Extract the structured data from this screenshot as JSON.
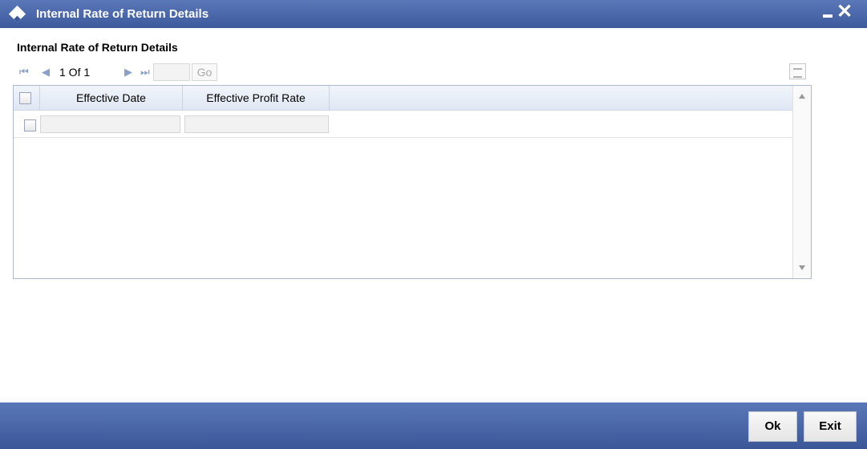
{
  "window": {
    "title": "Internal Rate of Return Details",
    "minimize_icon": "minimize-icon",
    "close_icon": "close-icon",
    "accent": "#3d5a9d"
  },
  "section": {
    "title": "Internal Rate of Return Details"
  },
  "pagination": {
    "page_text": "1 Of 1",
    "page_value": "",
    "go_label": "Go"
  },
  "grid": {
    "columns": [
      "Effective Date",
      "Effective Profit Rate"
    ],
    "rows": [
      {
        "selected": false,
        "effective_date": "",
        "effective_profit_rate": ""
      }
    ]
  },
  "footer": {
    "ok_label": "Ok",
    "exit_label": "Exit"
  }
}
